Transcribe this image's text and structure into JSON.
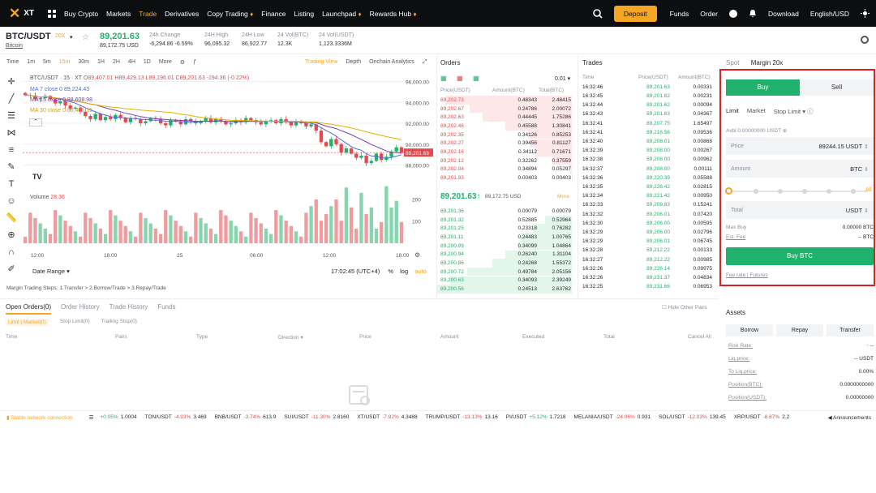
{
  "nav": {
    "logo": "XT",
    "items": [
      "Buy Crypto",
      "Markets",
      "Trade",
      "Derivatives",
      "Copy Trading",
      "Finance",
      "Listing",
      "Launchpad",
      "Rewards Hub"
    ],
    "active": "Trade",
    "deposit": "Deposit",
    "funds": "Funds",
    "order": "Order",
    "download": "Download",
    "lang": "English/USD"
  },
  "ticker": {
    "pair": "BTC/USDT",
    "leverage": "20X",
    "name": "Bitcoin",
    "last": "89,201.63",
    "last_usd": "89,172.75 USD",
    "change_label": "24h Change",
    "change": "-6,294.86 -6.59%",
    "high_label": "24H High",
    "high": "96,095.32",
    "low_label": "24H Low",
    "low": "86,922.77",
    "vol_label": "24 Vol(BTC)",
    "vol": "12.3K",
    "vol2_label": "24 Vol(USDT)",
    "vol2": "1,123.3336M"
  },
  "chart_tabs": [
    "Time",
    "1m",
    "5m",
    "15m",
    "30m",
    "1H",
    "2H",
    "4H",
    "1D",
    "More"
  ],
  "chart_tab_active": "15m",
  "chart_views": [
    "Trading View",
    "Depth",
    "Onchain Analytics"
  ],
  "chart_view_active": "Trading View",
  "chart": {
    "title": "BTC/USDT · 15 · XT",
    "ohlc": "O89,407.01  H89,429.13  L89,196.01  C89,201.63  -194.36 (-0.22%)",
    "ma7": "MA 7 close 0  89,224.43",
    "ma15": "MA 15 close 0  88,608.98",
    "ma30": "MA 30 close 0  89,405.15",
    "volume_label": "Volume",
    "volume_val": "28.36",
    "price_tag": "89,201.63",
    "date_range": "Date Range",
    "clock": "17:02:45 (UTC+4)",
    "pct": "%",
    "log": "log",
    "auto": "auto"
  },
  "chart_data": {
    "type": "candlestick",
    "x_ticks": [
      "12:00",
      "18:00",
      "25",
      "06:00",
      "12:00",
      "18:00"
    ],
    "y_ticks": [
      96000,
      94000,
      92000,
      90000,
      88000
    ],
    "ylim": [
      86500,
      96500
    ],
    "vol_ticks": [
      200,
      100
    ],
    "close": [
      94700,
      94650,
      94300,
      94400,
      94600,
      94300,
      93900,
      94100,
      93700,
      93400,
      93500,
      93100,
      92700,
      92400,
      92900,
      92300,
      92600,
      92400,
      92800,
      92500,
      92100,
      92500,
      92400,
      92000,
      92200,
      92500,
      92400,
      92000,
      91800,
      92300,
      92200,
      91900,
      92400,
      92200,
      92000,
      92200,
      92500,
      92100,
      92400,
      92200,
      91900,
      92000,
      92300,
      92100,
      92500,
      92300,
      92100,
      91900,
      92200,
      92300,
      92000,
      92400,
      92100,
      91800,
      92200,
      92000,
      91700,
      91900,
      91300,
      90200,
      89800,
      90500,
      90000,
      89200,
      89600,
      89100,
      88700,
      88900,
      88200,
      88400,
      89100,
      88500,
      88800,
      89300,
      89700,
      89200
    ]
  },
  "margin_steps": "Margin Trading Steps: 1.Transfer > 2.Borrow/Trade > 3.Repay/Trade",
  "orderbook": {
    "title": "Orders",
    "depth": "0.01",
    "headers": [
      "Price(USDT)",
      "Amount(BTC)",
      "Total(BTC)"
    ],
    "asks": [
      [
        "89,202.73",
        "0.48343",
        "2.48415"
      ],
      [
        "89,202.67",
        "0.24786",
        "2.00072"
      ],
      [
        "89,202.63",
        "0.44445",
        "1.75286"
      ],
      [
        "89,202.46",
        "0.45588",
        "1.30841"
      ],
      [
        "89,202.35",
        "0.34126",
        "0.85253"
      ],
      [
        "89,202.27",
        "0.39456",
        "0.81127"
      ],
      [
        "89,202.16",
        "0.34112",
        "0.71671"
      ],
      [
        "89,202.12",
        "0.32262",
        "0.37559"
      ],
      [
        "89,202.04",
        "0.34894",
        "0.05297"
      ],
      [
        "89,201.93",
        "0.00403",
        "0.00403"
      ]
    ],
    "mid": "89,201.63",
    "mid_sub": "89,172.75 USD",
    "more": "More",
    "bids": [
      [
        "89,201.36",
        "0.00079",
        "0.00079"
      ],
      [
        "89,201.32",
        "0.52885",
        "0.52964"
      ],
      [
        "89,201.25",
        "0.23318",
        "0.76282"
      ],
      [
        "89,201.11",
        "0.24483",
        "1.00765"
      ],
      [
        "89,200.99",
        "0.34099",
        "1.04864"
      ],
      [
        "89,200.94",
        "0.26240",
        "1.31104"
      ],
      [
        "89,200.86",
        "0.24268",
        "1.55372"
      ],
      [
        "89,200.72",
        "0.49784",
        "2.05156"
      ],
      [
        "89,200.63",
        "0.34093",
        "2.39249"
      ],
      [
        "89,200.56",
        "0.24513",
        "2.63762"
      ]
    ]
  },
  "trades": {
    "title": "Trades",
    "headers": [
      "Time",
      "Price(USDT)",
      "Amount(BTC)"
    ],
    "rows": [
      [
        "16:32:46",
        "89,201.63",
        "0.00331"
      ],
      [
        "16:32:45",
        "89,201.62",
        "0.00231"
      ],
      [
        "16:32:44",
        "89,201.62",
        "0.00094"
      ],
      [
        "16:32:43",
        "89,201.63",
        "0.04367"
      ],
      [
        "16:32:41",
        "89,207.75",
        "1.65497"
      ],
      [
        "16:32:41",
        "89,216.56",
        "0.09536"
      ],
      [
        "16:32:40",
        "89,208.01",
        "0.00868"
      ],
      [
        "16:32:39",
        "89,208.00",
        "0.00267"
      ],
      [
        "16:32:38",
        "89,208.00",
        "0.00962"
      ],
      [
        "16:32:37",
        "89,208.00",
        "0.00111"
      ],
      [
        "16:32:36",
        "89,220.39",
        "0.05588"
      ],
      [
        "16:32:35",
        "89,226.42",
        "0.02815"
      ],
      [
        "16:32:34",
        "89,221.42",
        "0.00950"
      ],
      [
        "16:32:33",
        "89,209.83",
        "0.15241"
      ],
      [
        "16:32:32",
        "89,206.01",
        "0.07420"
      ],
      [
        "16:32:30",
        "89,206.00",
        "0.00595"
      ],
      [
        "16:32:29",
        "89,206.00",
        "0.02796"
      ],
      [
        "16:32:29",
        "89,206.01",
        "0.06745"
      ],
      [
        "16:32:28",
        "89,212.22",
        "0.00133"
      ],
      [
        "16:32:27",
        "89,212.22",
        "0.00985"
      ],
      [
        "16:32:26",
        "89,226.14",
        "0.09975"
      ],
      [
        "16:32:26",
        "89,231.37",
        "0.04834"
      ],
      [
        "16:32:25",
        "89,231.66",
        "0.06953"
      ]
    ]
  },
  "trade_panel": {
    "tabs": [
      "Spot",
      "Margin 20x"
    ],
    "buy": "Buy",
    "sell": "Sell",
    "order_types": [
      "Limit",
      "Market",
      "Stop Limit"
    ],
    "avbl": "Avbl 0.00000000 USDT",
    "price_label": "Price",
    "price_value": "89244.15",
    "price_unit": "USDT",
    "amount_label": "Amount",
    "amount_unit": "BTC",
    "slider_pct": 0,
    "all": "All",
    "total_label": "Total",
    "total_unit": "USDT",
    "max_buy_label": "Max Buy",
    "max_buy": "0.00000 BTC",
    "est_fee_label": "Est. Fee",
    "est_fee": "-- BTC",
    "buy_btn": "Buy BTC",
    "fee_rate": "Fee rate",
    "futures": "Futures"
  },
  "bottom": {
    "tabs": [
      "Open Orders(0)",
      "Order History",
      "Trade History",
      "Funds"
    ],
    "hide_label": "Hide Other Pairs",
    "subtabs": [
      "Limit | Market(0)",
      "Stop Limit(0)",
      "Trailing Stop(0)"
    ],
    "headers": [
      "Time",
      "Pairs",
      "Type",
      "Direction",
      "Price",
      "Amount",
      "Executed",
      "Total",
      "Cancel All"
    ]
  },
  "assets": {
    "title": "Assets",
    "buttons": [
      "Borrow",
      "Repay",
      "Transfer"
    ],
    "rows": [
      [
        "Risk Rate:",
        "--"
      ],
      [
        "Liq.price:",
        "-- USDT"
      ],
      [
        "To Liq.price:",
        "0.00%"
      ],
      [
        "Position(BTC):",
        "0.0000000000"
      ],
      [
        "Position(USDT):",
        "0.00000000"
      ]
    ]
  },
  "statusbar": {
    "connection": "Stable network connection",
    "items": [
      {
        "pair": "",
        "chg": "+0.05%",
        "px": "1.0004"
      },
      {
        "pair": "TON/USDT",
        "chg": "-4.93%",
        "px": "3.469"
      },
      {
        "pair": "BNB/USDT",
        "chg": "-3.74%",
        "px": "613.9"
      },
      {
        "pair": "SUI/USDT",
        "chg": "-11.30%",
        "px": "2.8160"
      },
      {
        "pair": "XT/USDT",
        "chg": "-7.92%",
        "px": "4.3488"
      },
      {
        "pair": "TRUMP/USDT",
        "chg": "-13.13%",
        "px": "13.16"
      },
      {
        "pair": "PI/USDT",
        "chg": "+5.12%",
        "px": "1.7218"
      },
      {
        "pair": "MELANIA/USDT",
        "chg": "-24.06%",
        "px": "0.931"
      },
      {
        "pair": "SOL/USDT",
        "chg": "-12.03%",
        "px": "139.45"
      },
      {
        "pair": "XRP/USDT",
        "chg": "-8.87%",
        "px": "2.2"
      }
    ],
    "announcements": "Announcements"
  },
  "colors": {
    "accent": "#f5a623",
    "up": "#20b26c",
    "down": "#e5484d",
    "highlight": "#e02020"
  }
}
